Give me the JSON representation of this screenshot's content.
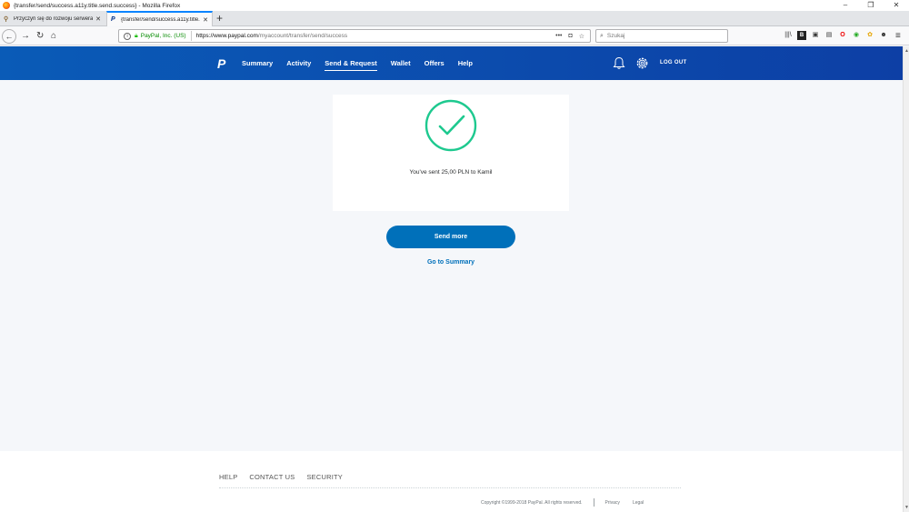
{
  "window": {
    "title": "{transfer/send/success.a11y.title.send.success} - Mozilla Firefox",
    "controls": [
      "–",
      "❐",
      "✕"
    ]
  },
  "tabs": [
    {
      "label": "Przyczyń się do rozwoju serwera",
      "active": false
    },
    {
      "label": "{transfer/send/success.a11y.title.send.success}",
      "active": true
    }
  ],
  "urlbar": {
    "org": "PayPal, Inc. (US)",
    "url_host": "https://www.paypal.com",
    "url_rest": "/myaccount/transfer/send/success"
  },
  "search": {
    "placeholder": "Szukaj"
  },
  "paypal": {
    "logo": "P",
    "nav": [
      "Summary",
      "Activity",
      "Send & Request",
      "Wallet",
      "Offers",
      "Help"
    ],
    "active_nav": "Send & Request",
    "logout": "LOG OUT"
  },
  "content": {
    "message": "You've sent 25,00 PLN to Kamil",
    "send_more": "Send more",
    "go_to_summary": "Go to Summary"
  },
  "footer": {
    "links": [
      "HELP",
      "CONTACT US",
      "SECURITY"
    ],
    "copyright": "Copyright ©1999-2018 PayPal. All rights reserved.",
    "privacy": "Privacy",
    "legal": "Legal"
  },
  "colors": {
    "brand_blue": "#0070ba",
    "header_blue": "#0a5bb7",
    "success_green": "#1ec98f"
  }
}
